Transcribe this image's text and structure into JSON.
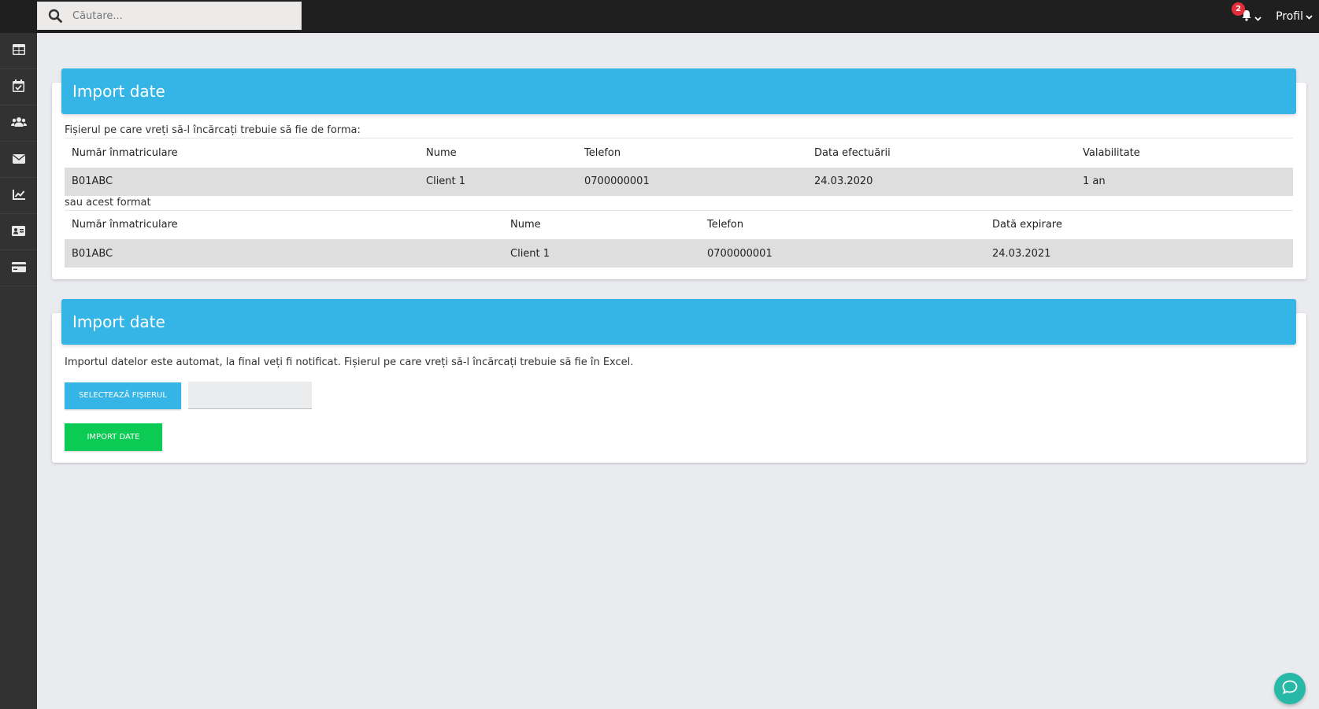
{
  "search": {
    "placeholder": "Căutare..."
  },
  "header": {
    "notification_count": "2",
    "profile_label": "Profil"
  },
  "sidebar": {
    "items": [
      {
        "icon": "table-icon"
      },
      {
        "icon": "calendar-check-icon"
      },
      {
        "icon": "users-icon"
      },
      {
        "icon": "envelope-icon"
      },
      {
        "icon": "chart-line-icon"
      },
      {
        "icon": "id-card-icon"
      },
      {
        "icon": "credit-card-icon"
      }
    ]
  },
  "card1": {
    "title": "Import date",
    "intro": "Fișierul pe care vreți să-l încărcați trebuie să fie de forma:",
    "table1": {
      "headers": [
        "Număr înmatriculare",
        "Nume",
        "Telefon",
        "Data efectuării",
        "Valabilitate"
      ],
      "row": [
        "B01ABC",
        "Client 1",
        "0700000001",
        "24.03.2020",
        "1 an"
      ]
    },
    "or_text": "sau acest format",
    "table2": {
      "headers": [
        "Număr înmatriculare",
        "Nume",
        "Telefon",
        "Dată expirare"
      ],
      "row": [
        "B01ABC",
        "Client 1",
        "0700000001",
        "24.03.2021"
      ]
    }
  },
  "card2": {
    "title": "Import date",
    "intro": "Importul datelor este automat, la final veți fi notificat. Fișierul pe care vreți să-l încărcați trebuie să fie în Excel.",
    "select_label": "Selectează fișierul",
    "import_label": "Import date"
  },
  "colors": {
    "accent": "#34b5e6",
    "success": "#0ccb54",
    "badge": "#e52d3a",
    "chat": "#27b8a8"
  }
}
